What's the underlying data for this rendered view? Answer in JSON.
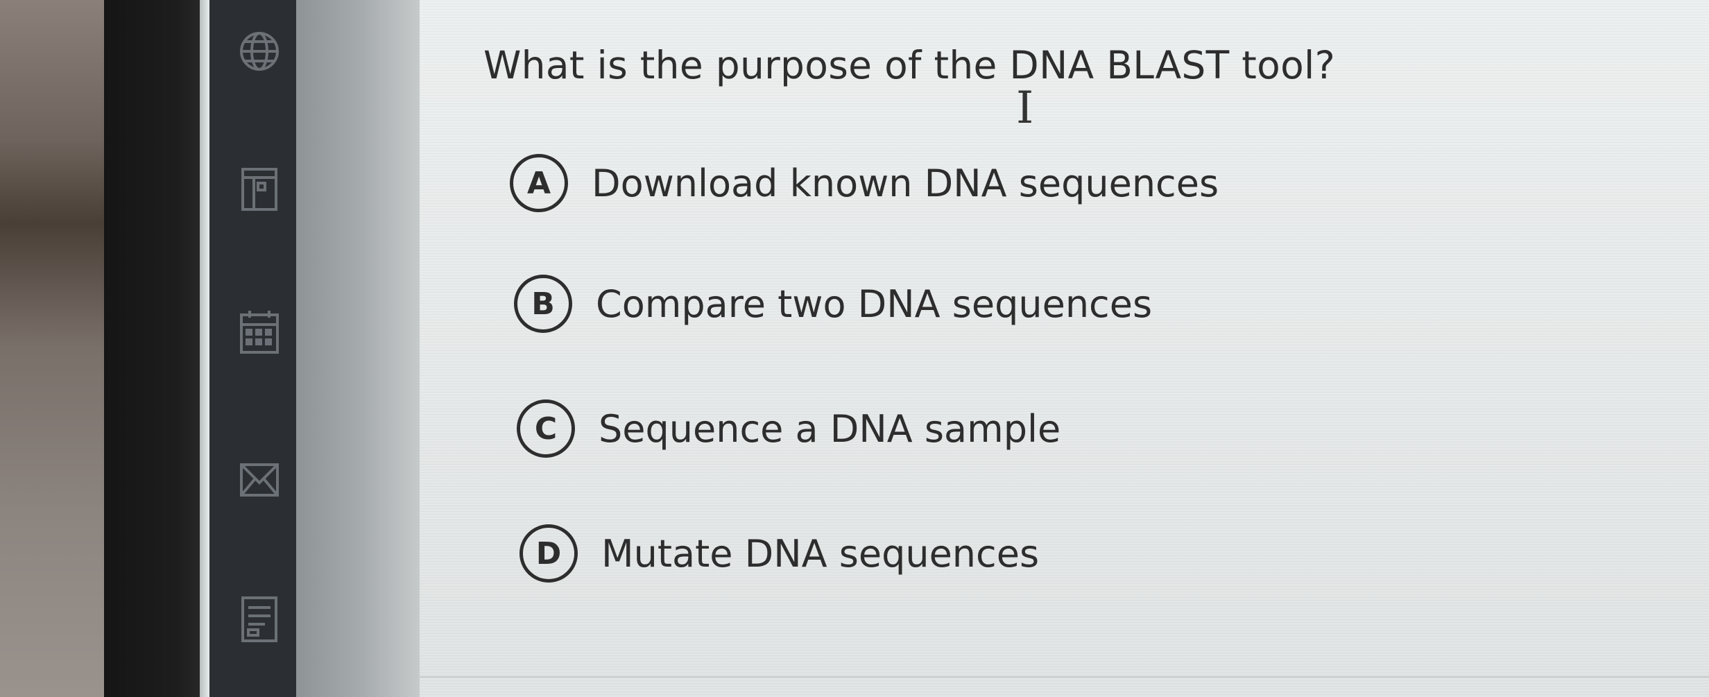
{
  "question": {
    "text": "What is the purpose of the DNA BLAST tool?"
  },
  "options": [
    {
      "letter": "A",
      "text": "Download known DNA sequences"
    },
    {
      "letter": "B",
      "text": "Compare two DNA sequences"
    },
    {
      "letter": "C",
      "text": "Sequence a DNA sample"
    },
    {
      "letter": "D",
      "text": "Mutate DNA sequences"
    }
  ],
  "sidebar": {
    "icons": [
      "globe-icon",
      "layout-icon",
      "calendar-icon",
      "mail-icon",
      "document-icon"
    ]
  },
  "colors": {
    "text": "#2d2d2d",
    "content_bg": "#e9ecec",
    "sidebar_bg": "#2b2f33",
    "sidebar_icon": "#6b7176"
  }
}
